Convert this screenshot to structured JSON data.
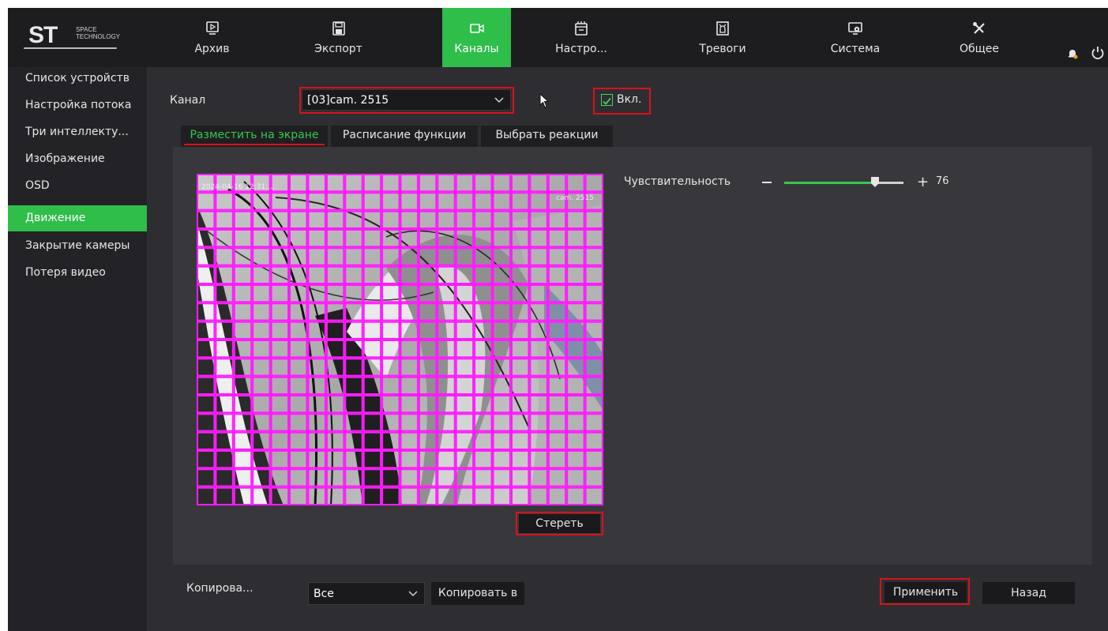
{
  "logo": {
    "mark": "ST",
    "line1": "SPACE",
    "line2": "TECHNOLOGY"
  },
  "nav": [
    {
      "label": "Архив",
      "icon": "play-monitor-icon"
    },
    {
      "label": "Экспорт",
      "icon": "floppy-disk-icon"
    },
    {
      "label": "Каналы",
      "icon": "camera-icon",
      "active": true
    },
    {
      "label": "Настро...",
      "icon": "film-frame-icon"
    },
    {
      "label": "Тревоги",
      "icon": "alarm-siren-icon"
    },
    {
      "label": "Система",
      "icon": "monitor-gear-icon"
    },
    {
      "label": "Общее",
      "icon": "tools-icon"
    }
  ],
  "sidebar": [
    {
      "label": "Список устройств"
    },
    {
      "label": "Настройка потока"
    },
    {
      "label": "Три интеллекту..."
    },
    {
      "label": "Изображение"
    },
    {
      "label": "OSD"
    },
    {
      "label": "Движение",
      "active": true
    },
    {
      "label": "Закрытие камеры"
    },
    {
      "label": "Потеря видео"
    }
  ],
  "channel": {
    "label": "Канал",
    "value": "[03]cam. 2515"
  },
  "enable": {
    "label": "Вкл.",
    "checked": true
  },
  "tabs": [
    {
      "label": "Разместить на экране",
      "active": true
    },
    {
      "label": "Расписание функции"
    },
    {
      "label": "Выбрать реакции"
    }
  ],
  "video": {
    "osd_datetime": "2024-04-16 12:31:...",
    "osd_camera": "cam. 2515",
    "grid_color": "#ff1cff"
  },
  "sensitivity": {
    "label": "Чувствительность",
    "value": 76,
    "display": "76",
    "min": 0,
    "max": 100
  },
  "erase_button": "Стереть",
  "copy": {
    "label": "Копирова...",
    "selected": "Все",
    "button": "Копировать в"
  },
  "apply_button": "Применить",
  "back_button": "Назад",
  "colors": {
    "accent": "#2fbe4a",
    "highlight": "#d9111a",
    "background": "#2e2e32"
  }
}
